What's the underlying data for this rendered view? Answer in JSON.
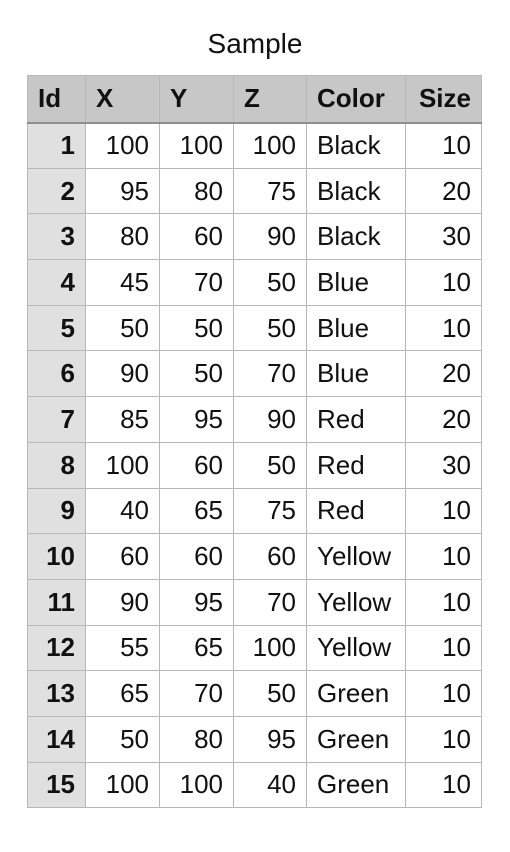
{
  "title": "Sample",
  "chart_data": {
    "type": "table",
    "title": "Sample",
    "columns": [
      "Id",
      "X",
      "Y",
      "Z",
      "Color",
      "Size"
    ],
    "rows": [
      [
        "1",
        "100",
        "100",
        "100",
        "Black",
        "10"
      ],
      [
        "2",
        "95",
        "80",
        "75",
        "Black",
        "20"
      ],
      [
        "3",
        "80",
        "60",
        "90",
        "Black",
        "30"
      ],
      [
        "4",
        "45",
        "70",
        "50",
        "Blue",
        "10"
      ],
      [
        "5",
        "50",
        "50",
        "50",
        "Blue",
        "10"
      ],
      [
        "6",
        "90",
        "50",
        "70",
        "Blue",
        "20"
      ],
      [
        "7",
        "85",
        "95",
        "90",
        "Red",
        "20"
      ],
      [
        "8",
        "100",
        "60",
        "50",
        "Red",
        "30"
      ],
      [
        "9",
        "40",
        "65",
        "75",
        "Red",
        "10"
      ],
      [
        "10",
        "60",
        "60",
        "60",
        "Yellow",
        "10"
      ],
      [
        "11",
        "90",
        "95",
        "70",
        "Yellow",
        "10"
      ],
      [
        "12",
        "55",
        "65",
        "100",
        "Yellow",
        "10"
      ],
      [
        "13",
        "65",
        "70",
        "50",
        "Green",
        "10"
      ],
      [
        "14",
        "50",
        "80",
        "95",
        "Green",
        "10"
      ],
      [
        "15",
        "100",
        "100",
        "40",
        "Green",
        "10"
      ]
    ]
  }
}
